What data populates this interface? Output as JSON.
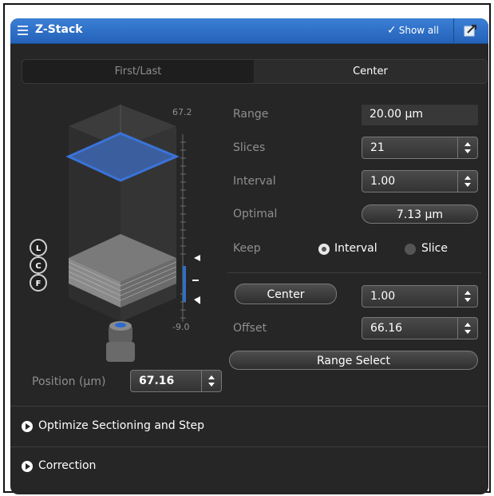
{
  "header": {
    "title": "Z-Stack",
    "show_all_label": "Show all"
  },
  "tabs": [
    {
      "label": "First/Last",
      "active": false
    },
    {
      "label": "Center",
      "active": true
    }
  ],
  "scale": {
    "top_label": "67.2",
    "bottom_label": "-9.0"
  },
  "markers": {
    "last": "L",
    "center": "C",
    "first": "F"
  },
  "fields": {
    "range_label": "Range",
    "range_value": "20.00 µm",
    "slices_label": "Slices",
    "slices_value": "21",
    "interval_label": "Interval",
    "interval_value": "1.00",
    "optimal_label": "Optimal",
    "optimal_value": "7.13 µm",
    "keep_label": "Keep",
    "keep_option_interval": "Interval",
    "keep_option_slice": "Slice"
  },
  "center": {
    "button_label": "Center",
    "step_value": "1.00",
    "offset_label": "Offset",
    "offset_value": "66.16",
    "range_select_label": "Range Select"
  },
  "position": {
    "label": "Position (µm)",
    "value": "67.16"
  },
  "sections": [
    {
      "label": "Optimize Sectioning and Step"
    },
    {
      "label": "Correction"
    }
  ],
  "colors": {
    "accent": "#2f6fc7",
    "focus_plane": "#3a73d8",
    "panel": "#262626"
  }
}
